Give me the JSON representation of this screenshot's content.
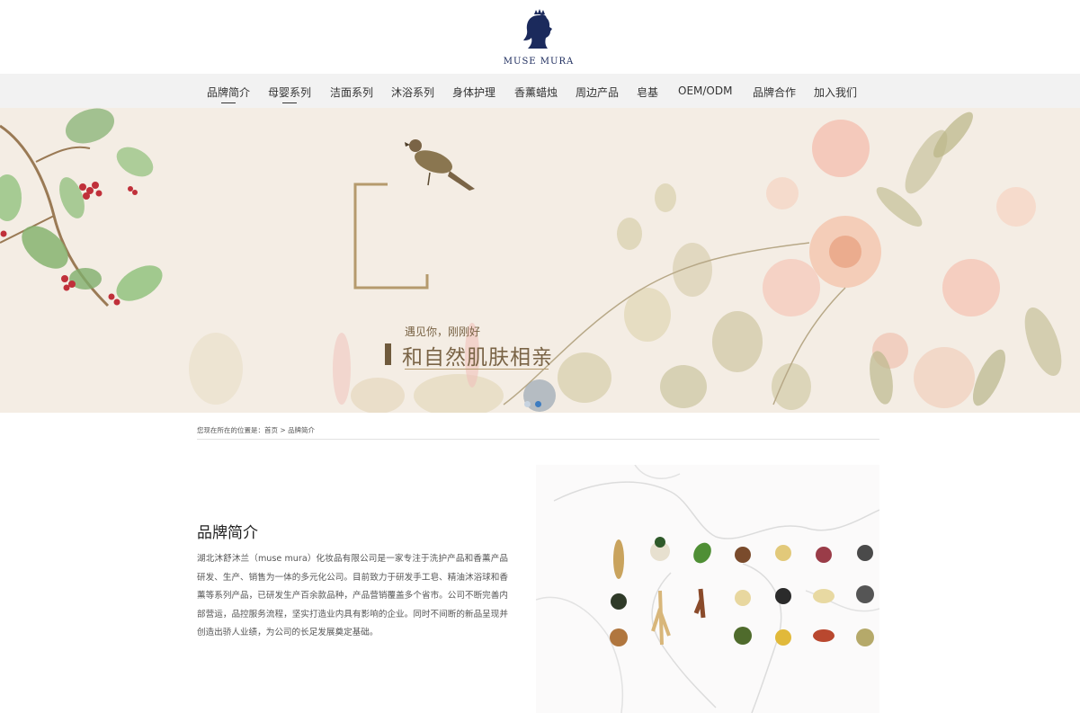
{
  "brand": {
    "name": "MUSE MURA",
    "color": "#1b2a5c"
  },
  "nav": {
    "items": [
      {
        "label": "品牌简介",
        "active": true
      },
      {
        "label": "母婴系列",
        "active": true
      },
      {
        "label": "洁面系列"
      },
      {
        "label": "沐浴系列"
      },
      {
        "label": "身体护理"
      },
      {
        "label": "香薰蜡烛"
      },
      {
        "label": "周边产品"
      },
      {
        "label": "皂基"
      },
      {
        "label": "OEM/ODM"
      },
      {
        "label": "品牌合作"
      },
      {
        "label": "加入我们"
      }
    ]
  },
  "banner": {
    "small_text": "遇见你，刚刚好",
    "big_text": "和自然肌肤相亲",
    "slides": 2,
    "active_slide": 2,
    "accent_color": "#b59a6d"
  },
  "breadcrumb": {
    "prefix": "您现在所在的位置是：",
    "home": "首页",
    "separator": " > ",
    "current": "品牌简介"
  },
  "intro": {
    "title": "品牌简介",
    "text": "湖北沐舒沐兰（muse mura）化妆品有限公司是一家专注于洗护产品和香薰产品研发、生产、销售为一体的多元化公司。目前致力于研发手工皂、精油沐浴球和香薰等系列产品，已研发生产百余款品种，产品营销覆盖多个省市。公司不断完善内部营运，品控服务流程，坚实打造业内具有影响的企业。同时不间断的新品呈现并创造出骄人业绩，为公司的长足发展奠定基础。"
  }
}
